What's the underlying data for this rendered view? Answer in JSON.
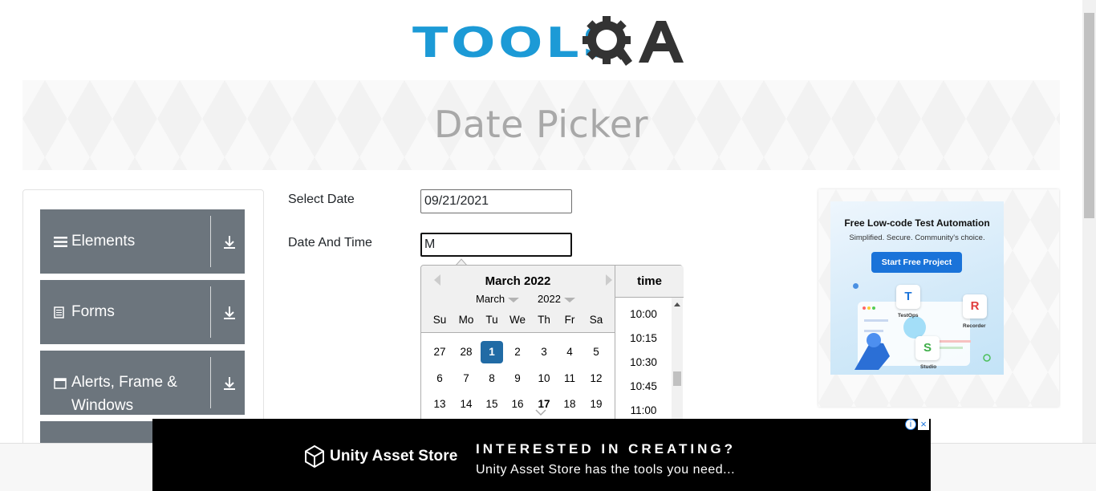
{
  "logo": {
    "text_tools": "TOOLS",
    "text_q": "Q",
    "text_a": "A"
  },
  "page": {
    "title": "Date Picker"
  },
  "sidebar": {
    "groups": [
      {
        "label": "Elements",
        "icon": "hamburger-icon"
      },
      {
        "label": "Forms",
        "icon": "document-icon"
      },
      {
        "label": "Alerts, Frame &",
        "label2": "Windows",
        "icon": "window-icon"
      }
    ]
  },
  "form": {
    "select_date_label": "Select Date",
    "select_date_value": "09/21/2021",
    "date_time_label": "Date And Time",
    "date_time_value": "M"
  },
  "datepicker": {
    "title": "March 2022",
    "month_select": "March",
    "year_select": "2022",
    "weekdays": [
      "Su",
      "Mo",
      "Tu",
      "We",
      "Th",
      "Fr",
      "Sa"
    ],
    "weeks": [
      [
        "27",
        "28",
        "1",
        "2",
        "3",
        "4",
        "5"
      ],
      [
        "6",
        "7",
        "8",
        "9",
        "10",
        "11",
        "12"
      ],
      [
        "13",
        "14",
        "15",
        "16",
        "17",
        "18",
        "19"
      ]
    ],
    "selected_day": "1",
    "today_day": "17",
    "time_header": "time",
    "times": [
      "10:00",
      "10:15",
      "10:30",
      "10:45",
      "11:00"
    ]
  },
  "ad_right": {
    "title": "Free Low-code Test Automation",
    "subtitle": "Simplified. Secure. Community's choice.",
    "button": "Start Free Project",
    "tile_testops": "TestOps",
    "tile_recorder": "Recorder",
    "tile_studio": "Studio"
  },
  "ad_bottom": {
    "brand": "Unity Asset Store",
    "headline": "INTERESTED IN CREATING?",
    "subline": "Unity Asset Store has the tools you need...",
    "info": "i",
    "close": "×"
  },
  "colors": {
    "brand_blue": "#1c9ad6",
    "sidebar_gray": "#6c757d",
    "selected_day": "#216ba5"
  }
}
